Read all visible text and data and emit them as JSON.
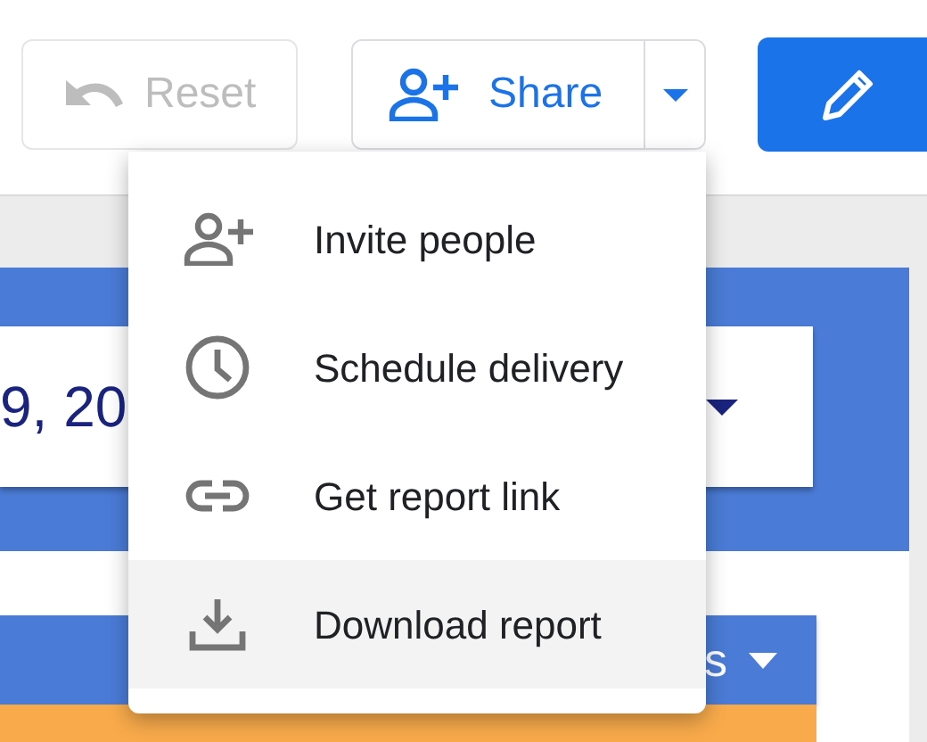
{
  "toolbar": {
    "reset": {
      "label": "Reset",
      "disabled": true
    },
    "share": {
      "label": "Share"
    }
  },
  "share_menu": {
    "expanded": true,
    "items": [
      {
        "label": "Invite people",
        "highlighted": false
      },
      {
        "label": "Schedule delivery",
        "highlighted": false
      },
      {
        "label": "Get report link",
        "highlighted": false
      },
      {
        "label": "Download report",
        "highlighted": true
      }
    ]
  },
  "date_range": {
    "value": "9, 20"
  },
  "table": {
    "columns": [
      "s"
    ]
  }
}
